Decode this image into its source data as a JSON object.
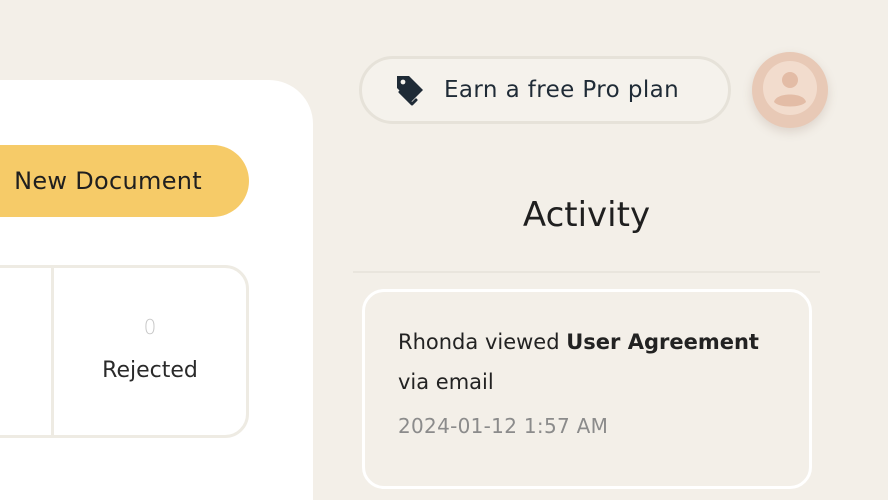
{
  "toolbar": {
    "new_document_label": "New Document"
  },
  "stats": {
    "rejected": {
      "count": "0",
      "label": "Rejected"
    }
  },
  "promo": {
    "label": "Earn a free Pro plan",
    "icon": "tag-icon"
  },
  "user": {
    "avatar_icon": "user-icon"
  },
  "activity": {
    "title": "Activity",
    "items": [
      {
        "actor": "Rhonda",
        "action": "viewed",
        "document": "User Agreement",
        "channel": "via email",
        "timestamp": "2024-01-12 1:57 AM"
      }
    ]
  },
  "colors": {
    "background": "#f3efe8",
    "panel": "#ffffff",
    "accent_button": "#f6cb68",
    "avatar": "#e8c9b6",
    "icon_dark": "#1f2b36"
  }
}
